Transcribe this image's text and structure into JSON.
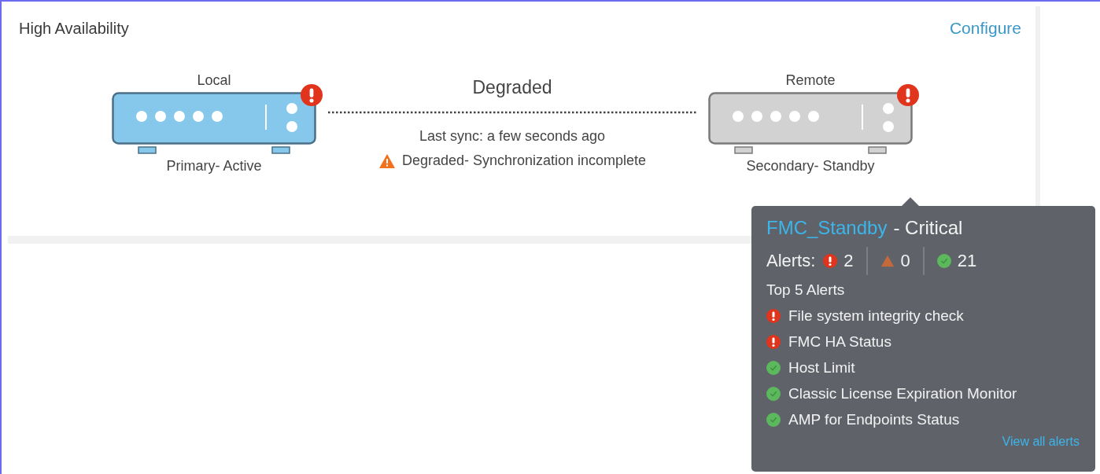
{
  "panel": {
    "title": "High Availability",
    "configure_link": "Configure"
  },
  "devices": [
    {
      "label": "Local",
      "role": "Primary- Active",
      "kind": "active",
      "alert": true
    },
    {
      "label": "Remote",
      "role": "Secondary- Standby",
      "kind": "standby",
      "alert": true
    }
  ],
  "link": {
    "status": "Degraded",
    "last_sync": "Last sync: a few seconds ago",
    "warning": "Degraded- Synchronization incomplete"
  },
  "tooltip": {
    "name": "FMC_Standby",
    "severity": "- Critical",
    "alerts_label": "Alerts:",
    "counts": [
      {
        "kind": "critical",
        "count": "2"
      },
      {
        "kind": "warning",
        "count": "0"
      },
      {
        "kind": "ok",
        "count": "21"
      }
    ],
    "top_heading": "Top 5 Alerts",
    "alerts": [
      {
        "kind": "critical",
        "name": "File system integrity check"
      },
      {
        "kind": "critical",
        "name": "FMC HA Status"
      },
      {
        "kind": "ok",
        "name": "Host Limit"
      },
      {
        "kind": "ok",
        "name": "Classic License Expiration Monitor"
      },
      {
        "kind": "ok",
        "name": "AMP for Endpoints Status"
      }
    ],
    "view_all": "View all alerts"
  }
}
